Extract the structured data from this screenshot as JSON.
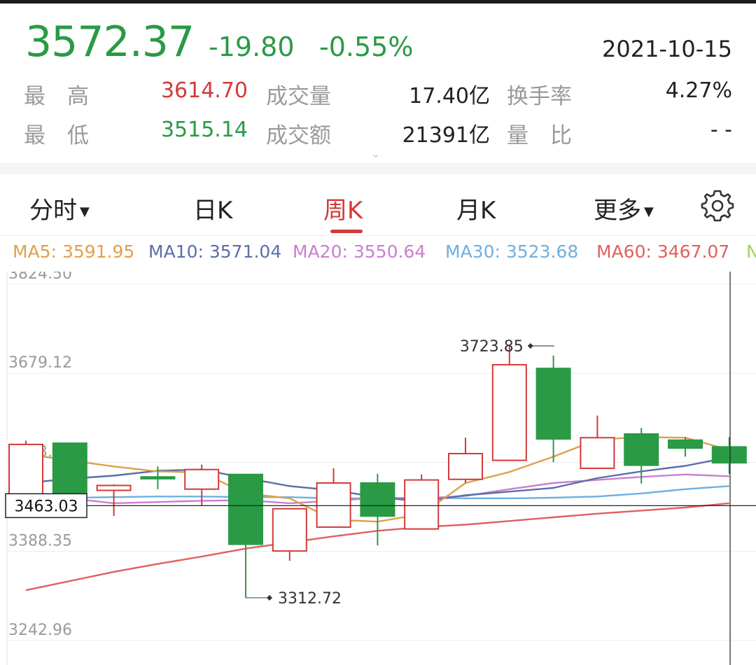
{
  "quote": {
    "price": "3572.37",
    "change": "-19.80",
    "change_pct": "-0.55%",
    "date": "2021-10-15",
    "high_label": "最　高",
    "high": "3614.70",
    "low_label": "最　低",
    "low": "3515.14",
    "volume_label": "成交量",
    "volume": "17.40亿",
    "amount_label": "成交额",
    "amount": "21391亿",
    "turnover_label": "换手率",
    "turnover": "4.27%",
    "ratio_label": "量　比",
    "ratio": "- -"
  },
  "tabs": [
    "分时",
    "日K",
    "周K",
    "月K",
    "更多"
  ],
  "ma_legend": [
    "MA5: 3591.95",
    "MA10: 3571.04",
    "MA20: 3550.64",
    "MA30: 3523.68",
    "MA60: 3467.07",
    "N"
  ],
  "colors": {
    "up": "#d23a3a",
    "down": "#2a9a45",
    "ma5": "#e0a04a",
    "ma10": "#5b6ea8",
    "ma20": "#c97fd0",
    "ma30": "#6db0e0",
    "ma60": "#e06060"
  },
  "chart_data": {
    "type": "candlestick",
    "y_ticks": [
      "3824.50",
      "3679.12",
      "3533.",
      "3388.35",
      "3242.96"
    ],
    "y_tick_values": [
      3824.5,
      3679.12,
      3533.74,
      3388.35,
      3242.96
    ],
    "ylim": [
      3222,
      3824.5
    ],
    "crosshair_label": "3463.03",
    "crosshair_value": 3463.03,
    "max_label": "3723.85",
    "max_value": 3723.85,
    "min_label": "3312.72",
    "min_value": 3312.72,
    "candles": [
      {
        "o": 3458,
        "h": 3569,
        "l": 3455,
        "c": 3563
      },
      {
        "o": 3565,
        "h": 3565,
        "l": 3480,
        "c": 3482
      },
      {
        "o": 3488,
        "h": 3498,
        "l": 3446,
        "c": 3496
      },
      {
        "o": 3510,
        "h": 3527,
        "l": 3490,
        "c": 3507
      },
      {
        "o": 3490,
        "h": 3530,
        "l": 3464,
        "c": 3522
      },
      {
        "o": 3514,
        "h": 3514,
        "l": 3313,
        "c": 3400
      },
      {
        "o": 3389,
        "h": 3452,
        "l": 3373,
        "c": 3458
      },
      {
        "o": 3428,
        "h": 3524,
        "l": 3427,
        "c": 3500
      },
      {
        "o": 3500,
        "h": 3515,
        "l": 3398,
        "c": 3446
      },
      {
        "o": 3425,
        "h": 3514,
        "l": 3424,
        "c": 3505
      },
      {
        "o": 3506,
        "h": 3574,
        "l": 3500,
        "c": 3548
      },
      {
        "o": 3537,
        "h": 3724,
        "l": 3537,
        "c": 3693
      },
      {
        "o": 3687,
        "h": 3708,
        "l": 3534,
        "c": 3572
      },
      {
        "o": 3524,
        "h": 3610,
        "l": 3524,
        "c": 3574
      },
      {
        "o": 3580,
        "h": 3590,
        "l": 3499,
        "c": 3529
      },
      {
        "o": 3570,
        "h": 3575,
        "l": 3543,
        "c": 3557
      },
      {
        "o": 3559,
        "h": 3575,
        "l": 3515,
        "c": 3533
      }
    ],
    "ma5": [
      3547,
      3537,
      3527,
      3519,
      3517,
      3483,
      3475,
      3440,
      3437,
      3449,
      3500,
      3518,
      3543,
      3571,
      3575,
      3574,
      3554
    ],
    "ma10": [
      3500,
      3507,
      3512,
      3520,
      3522,
      3508,
      3495,
      3488,
      3477,
      3470,
      3480,
      3486,
      3492,
      3508,
      3519,
      3528,
      3542
    ],
    "ma20": [
      3475,
      3475,
      3467,
      3469,
      3471,
      3472,
      3467,
      3471,
      3476,
      3475,
      3479,
      3490,
      3500,
      3505,
      3510,
      3514,
      3511
    ],
    "ma30": [
      3473,
      3476,
      3477,
      3478,
      3478,
      3477,
      3477,
      3475,
      3475,
      3476,
      3475,
      3475,
      3476,
      3478,
      3483,
      3490,
      3495
    ],
    "ma60": [
      3325,
      3340,
      3355,
      3368,
      3380,
      3393,
      3403,
      3413,
      3422,
      3428,
      3432,
      3438,
      3444,
      3450,
      3455,
      3460,
      3467
    ]
  }
}
